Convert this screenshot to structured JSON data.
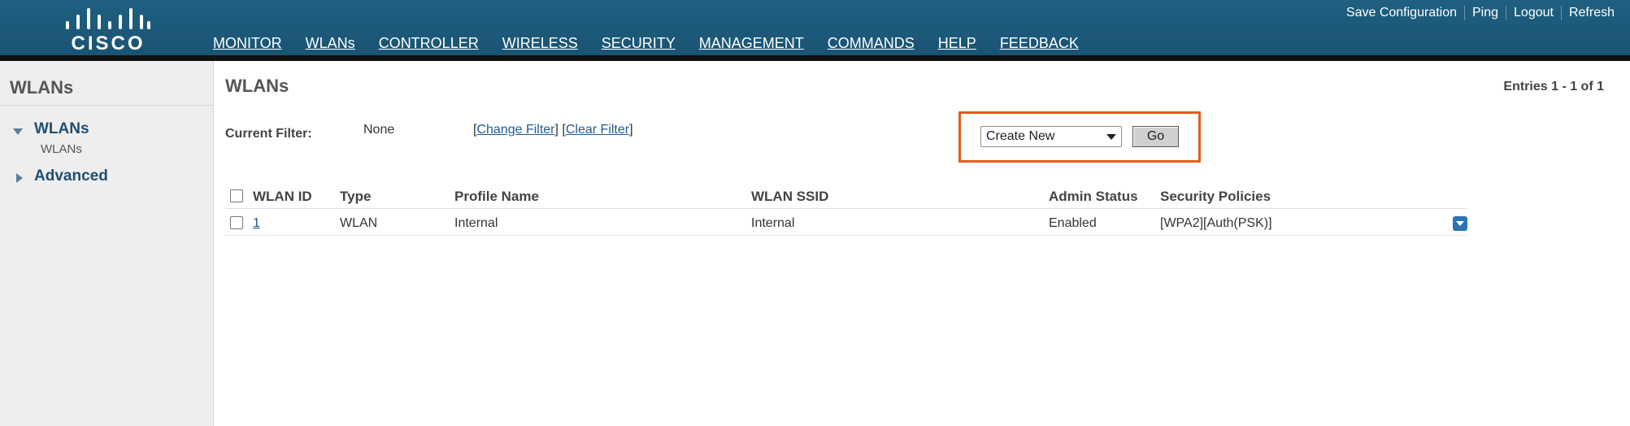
{
  "brand": {
    "logo_text": "CISCO"
  },
  "utility_links": [
    "Save Configuration",
    "Ping",
    "Logout",
    "Refresh"
  ],
  "nav": {
    "items": [
      "MONITOR",
      "WLANs",
      "CONTROLLER",
      "WIRELESS",
      "SECURITY",
      "MANAGEMENT",
      "COMMANDS",
      "HELP",
      "FEEDBACK"
    ],
    "active": "WLANs"
  },
  "sidebar": {
    "title": "WLANs",
    "section_wlans": "WLANs",
    "section_wlans_sub": "WLANs",
    "section_advanced": "Advanced"
  },
  "main": {
    "title": "WLANs",
    "entries": "Entries 1 - 1 of 1",
    "filter_label": "Current Filter:",
    "filter_value": "None",
    "change_filter": "Change Filter",
    "clear_filter": "Clear Filter",
    "action_select": "Create New",
    "go_button": "Go"
  },
  "table": {
    "headers": [
      "WLAN ID",
      "Type",
      "Profile Name",
      "WLAN SSID",
      "Admin Status",
      "Security Policies"
    ],
    "rows": [
      {
        "id": "1",
        "type": "WLAN",
        "profile": "Internal",
        "ssid": "Internal",
        "admin_status": "Enabled",
        "security": "[WPA2][Auth(PSK)]"
      }
    ]
  },
  "colors": {
    "header_bg": "#1a5474",
    "active_tab": "#f0932b",
    "highlight_border": "#e65c1b",
    "link": "#1d5c96"
  }
}
